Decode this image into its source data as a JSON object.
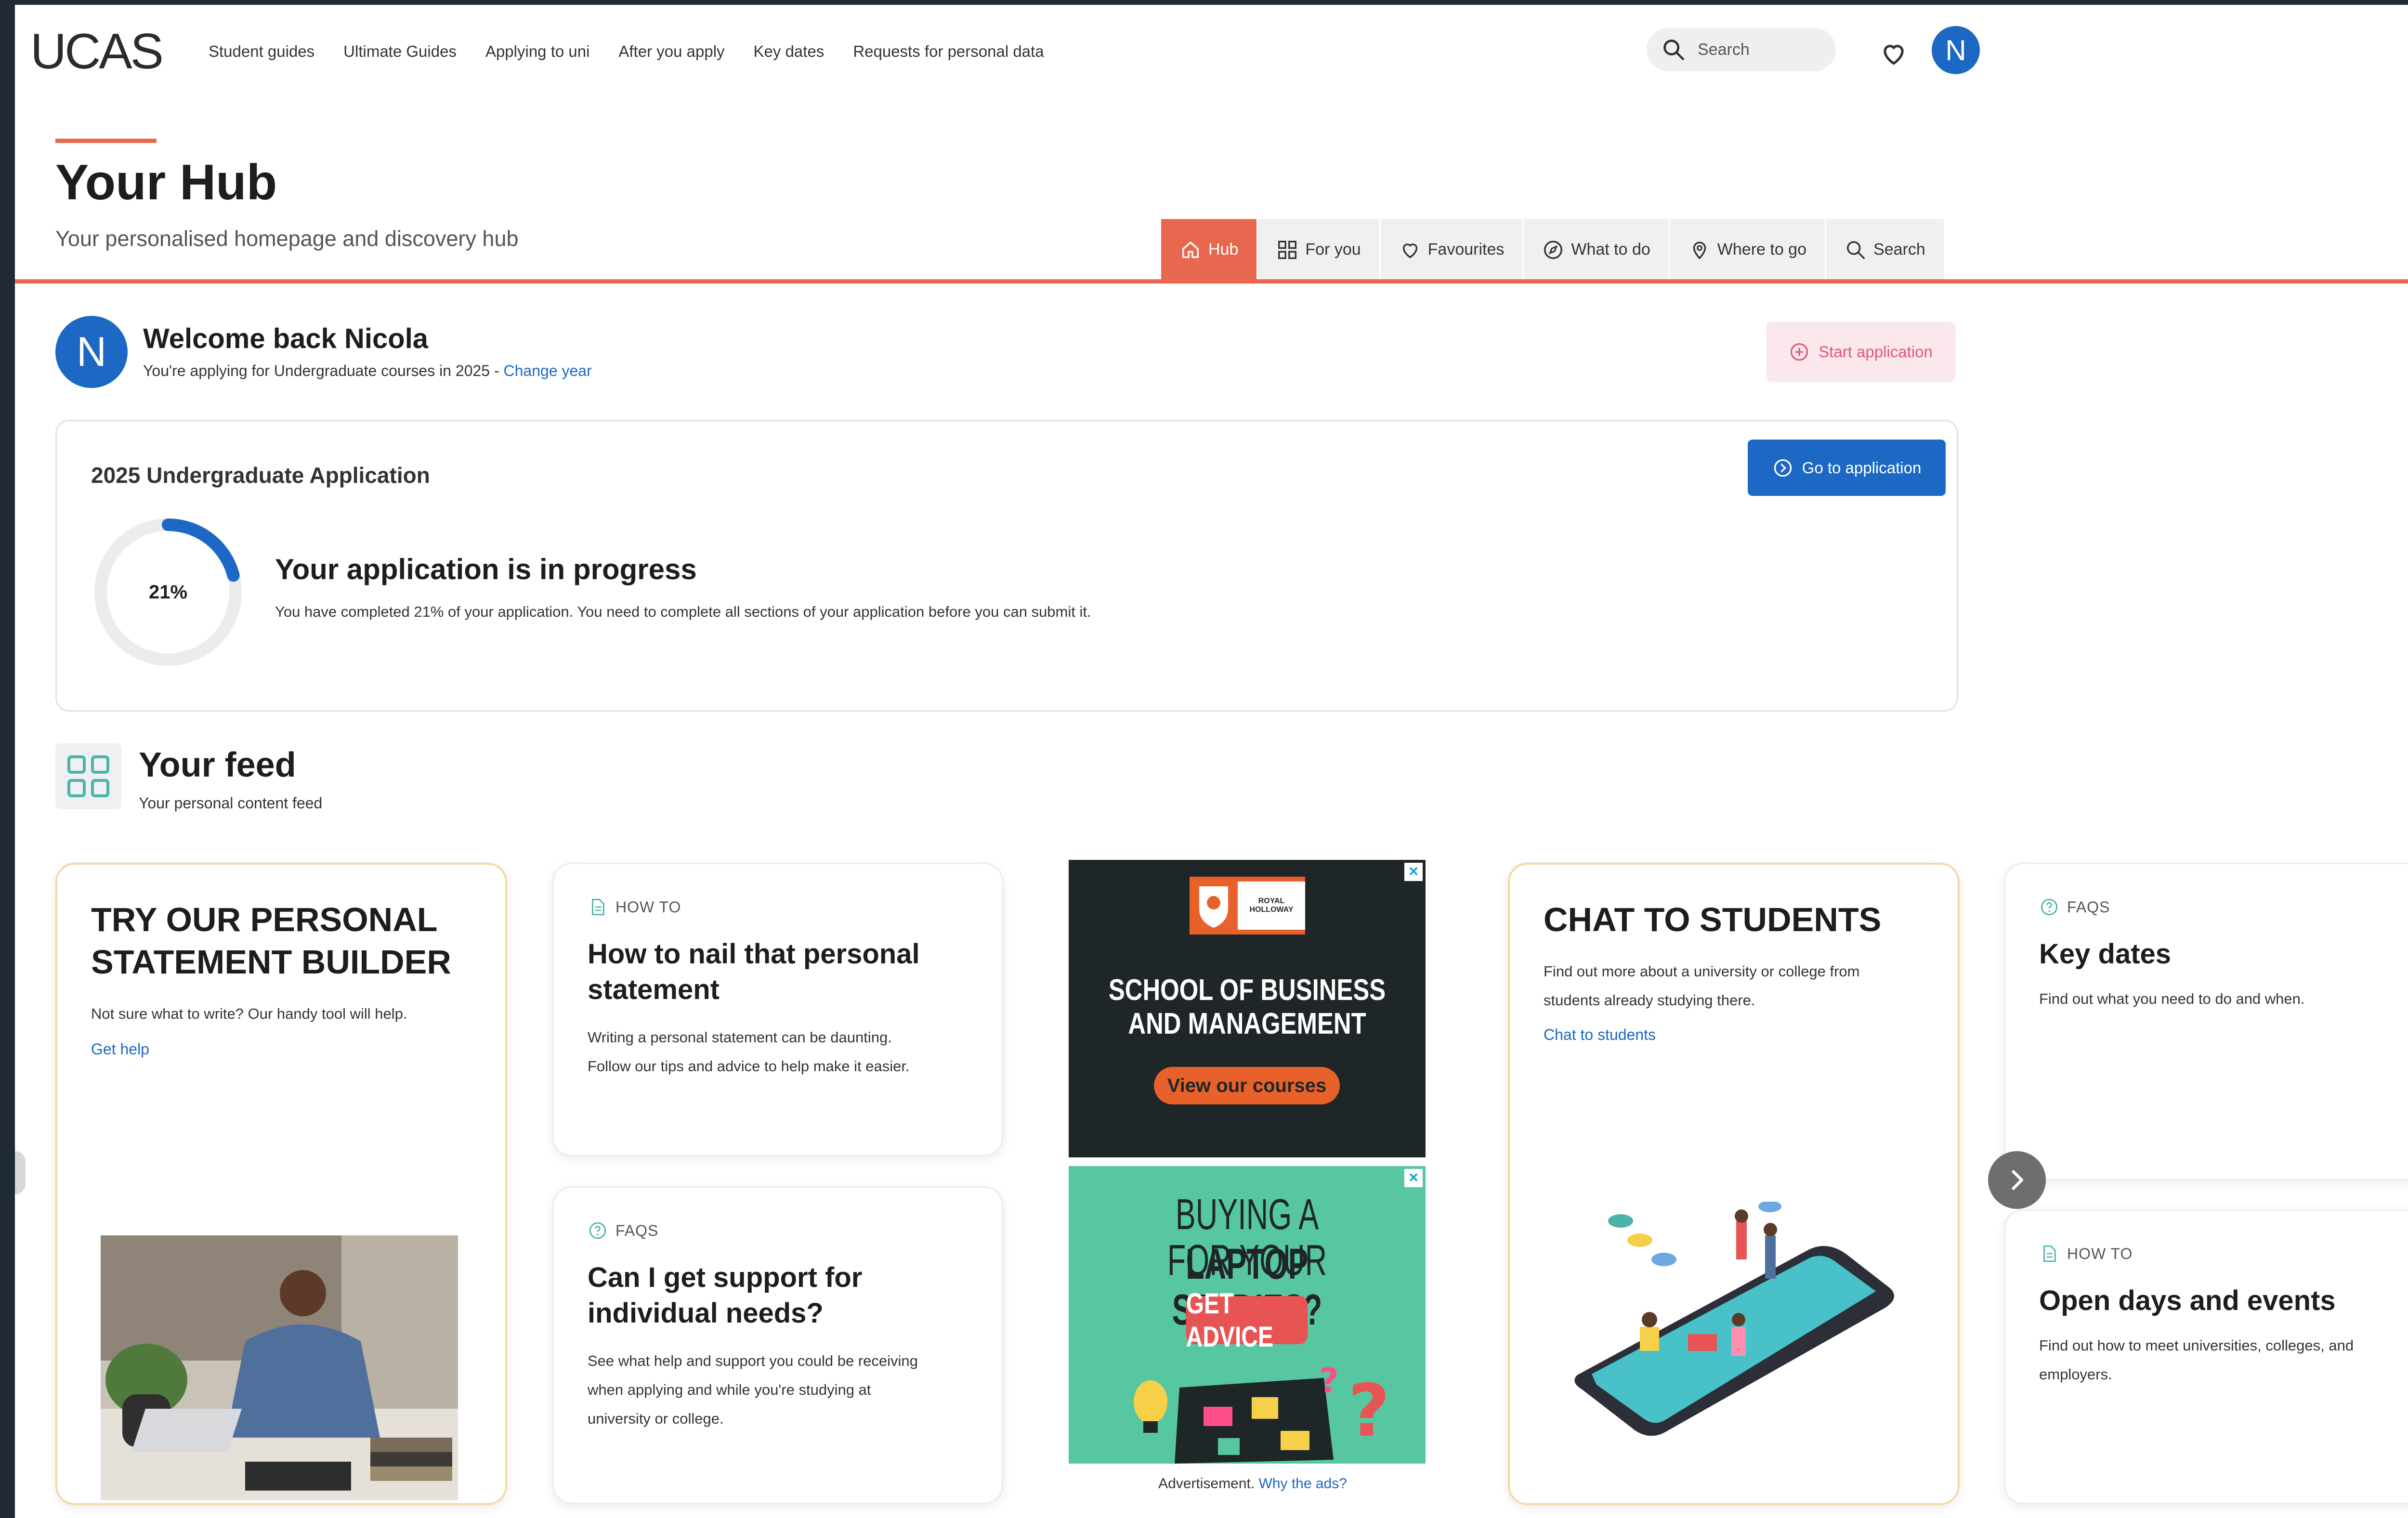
{
  "nav": {
    "logo": "UCAS",
    "links": [
      "Student guides",
      "Ultimate Guides",
      "Applying to uni",
      "After you apply",
      "Key dates",
      "Requests for personal data"
    ],
    "search_label": "Search",
    "avatar_initial": "N"
  },
  "hub": {
    "title": "Your Hub",
    "subtitle": "Your personalised homepage and discovery hub",
    "tabs": [
      {
        "label": "Hub",
        "icon": "home-icon"
      },
      {
        "label": "For you",
        "icon": "grid-icon"
      },
      {
        "label": "Favourites",
        "icon": "heart-icon"
      },
      {
        "label": "What to do",
        "icon": "compass-icon"
      },
      {
        "label": "Where to go",
        "icon": "location-pin-icon"
      },
      {
        "label": "Search",
        "icon": "search-icon"
      }
    ]
  },
  "welcome": {
    "initial": "N",
    "title": "Welcome back Nicola",
    "subtitle": "You're applying for Undergraduate courses in 2025 - ",
    "change_year": "Change year",
    "start_application": "Start application"
  },
  "application": {
    "title": "2025 Undergraduate Application",
    "go_button": "Go to application",
    "progress_fraction": 0.21,
    "progress_label": "21%",
    "status_title": "Your application is in progress",
    "status_text": "You have completed 21% of your application. You need to complete all sections of your application before you can submit it."
  },
  "feed": {
    "title": "Your feed",
    "subtitle": "Your personal content feed",
    "cards": {
      "statement_builder": {
        "title_line1": "TRY OUR PERSONAL",
        "title_line2": "STATEMENT BUILDER",
        "text": "Not sure what to write? Our handy tool will help.",
        "link": "Get help"
      },
      "nail_statement": {
        "tag": "HOW TO",
        "title_line1": "How to nail that personal",
        "title_line2": "statement",
        "text_line1": "Writing a personal statement can be daunting.",
        "text_line2": "Follow our tips and advice to help make it easier."
      },
      "support_needs": {
        "tag": "FAQS",
        "title_line1": "Can I get support for",
        "title_line2": "individual needs?",
        "text_line1": "See what help and support you could be receiving",
        "text_line2": "when applying and while you're studying at",
        "text_line3": "university or college."
      },
      "chat_students": {
        "title": "CHAT TO STUDENTS",
        "text_line1": "Find out more about a university or college from",
        "text_line2": "students already studying there.",
        "link": "Chat to students"
      },
      "key_dates": {
        "tag": "FAQS",
        "title": "Key dates",
        "text": "Find out what you need to do and when."
      },
      "open_days": {
        "tag": "HOW TO",
        "title": "Open days and events",
        "text_line1": "Find out how to meet universities, colleges, and",
        "text_line2": "employers."
      }
    },
    "ads": {
      "ad1": {
        "crest_line1": "ROYAL",
        "crest_line2": "HOLLOWAY",
        "line1": "SCHOOL OF BUSINESS",
        "line2": "AND MANAGEMENT",
        "button": "View our courses"
      },
      "ad2": {
        "line1a": "BUYING A ",
        "line1b": "LAPTOP",
        "line2a": "FOR YOUR ",
        "line2b": "STUDIES?",
        "button": "GET ADVICE"
      },
      "caption": "Advertisement. ",
      "caption_link": "Why the ads?"
    }
  },
  "colors": {
    "accent": "#e8684f",
    "primary": "#1c68c4",
    "promo_border": "#f3d9a4",
    "ad_dark": "#1f2628",
    "ad_orange": "#e8612a",
    "ad_green": "#57c7a1"
  }
}
